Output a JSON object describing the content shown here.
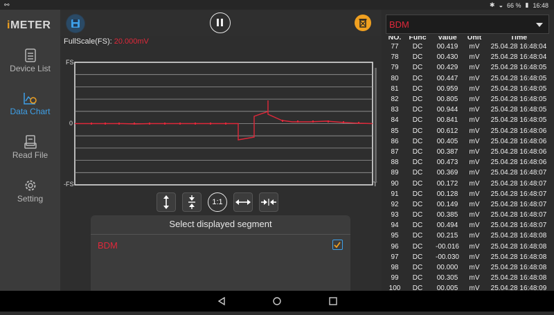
{
  "status": {
    "left_icon": "link-icon",
    "battery": "66 %",
    "time": "16:48"
  },
  "app": {
    "logo_i": "i",
    "logo_rest": "METER"
  },
  "nav": [
    {
      "label": "Device List",
      "icon": "list-icon"
    },
    {
      "label": "Data Chart",
      "icon": "chart-icon"
    },
    {
      "label": "Read File",
      "icon": "file-icon"
    },
    {
      "label": "Setting",
      "icon": "gear-icon"
    }
  ],
  "chart": {
    "fullscale_label": "FullScale(FS):",
    "fullscale_value": "20.000mV",
    "fs_top": "FS",
    "zero": "0",
    "fs_bottom": "-FS",
    "t_label": "T"
  },
  "controls": {
    "ratio_label": "1:1"
  },
  "segment": {
    "title": "Select displayed segment",
    "item": "BDM"
  },
  "panel": {
    "selected": "BDM",
    "headers": [
      "NO.",
      "Func",
      "Value",
      "Unit",
      "Time"
    ]
  },
  "rows": [
    [
      "77",
      "DC",
      "00.419",
      "mV",
      "25.04.28 16:48:04"
    ],
    [
      "78",
      "DC",
      "00.430",
      "mV",
      "25.04.28 16:48:04"
    ],
    [
      "79",
      "DC",
      "00.429",
      "mV",
      "25.04.28 16:48:05"
    ],
    [
      "80",
      "DC",
      "00.447",
      "mV",
      "25.04.28 16:48:05"
    ],
    [
      "81",
      "DC",
      "00.959",
      "mV",
      "25.04.28 16:48:05"
    ],
    [
      "82",
      "DC",
      "00.805",
      "mV",
      "25.04.28 16:48:05"
    ],
    [
      "83",
      "DC",
      "00.944",
      "mV",
      "25.04.28 16:48:05"
    ],
    [
      "84",
      "DC",
      "00.841",
      "mV",
      "25.04.28 16:48:05"
    ],
    [
      "85",
      "DC",
      "00.612",
      "mV",
      "25.04.28 16:48:06"
    ],
    [
      "86",
      "DC",
      "00.405",
      "mV",
      "25.04.28 16:48:06"
    ],
    [
      "87",
      "DC",
      "00.387",
      "mV",
      "25.04.28 16:48:06"
    ],
    [
      "88",
      "DC",
      "00.473",
      "mV",
      "25.04.28 16:48:06"
    ],
    [
      "89",
      "DC",
      "00.369",
      "mV",
      "25.04.28 16:48:07"
    ],
    [
      "90",
      "DC",
      "00.172",
      "mV",
      "25.04.28 16:48:07"
    ],
    [
      "91",
      "DC",
      "00.128",
      "mV",
      "25.04.28 16:48:07"
    ],
    [
      "92",
      "DC",
      "00.149",
      "mV",
      "25.04.28 16:48:07"
    ],
    [
      "93",
      "DC",
      "00.385",
      "mV",
      "25.04.28 16:48:07"
    ],
    [
      "94",
      "DC",
      "00.494",
      "mV",
      "25.04.28 16:48:07"
    ],
    [
      "95",
      "DC",
      "00.215",
      "mV",
      "25.04.28 16:48:08"
    ],
    [
      "96",
      "DC",
      "-00.016",
      "mV",
      "25.04.28 16:48:08"
    ],
    [
      "97",
      "DC",
      "-00.030",
      "mV",
      "25.04.28 16:48:08"
    ],
    [
      "98",
      "DC",
      "00.000",
      "mV",
      "25.04.28 16:48:08"
    ],
    [
      "99",
      "DC",
      "00.305",
      "mV",
      "25.04.28 16:48:08"
    ],
    [
      "100",
      "DC",
      "00.005",
      "mV",
      "25.04.28 16:48:09"
    ]
  ],
  "colors": {
    "accent": "#3ea0e8",
    "series": "#e0283a"
  }
}
